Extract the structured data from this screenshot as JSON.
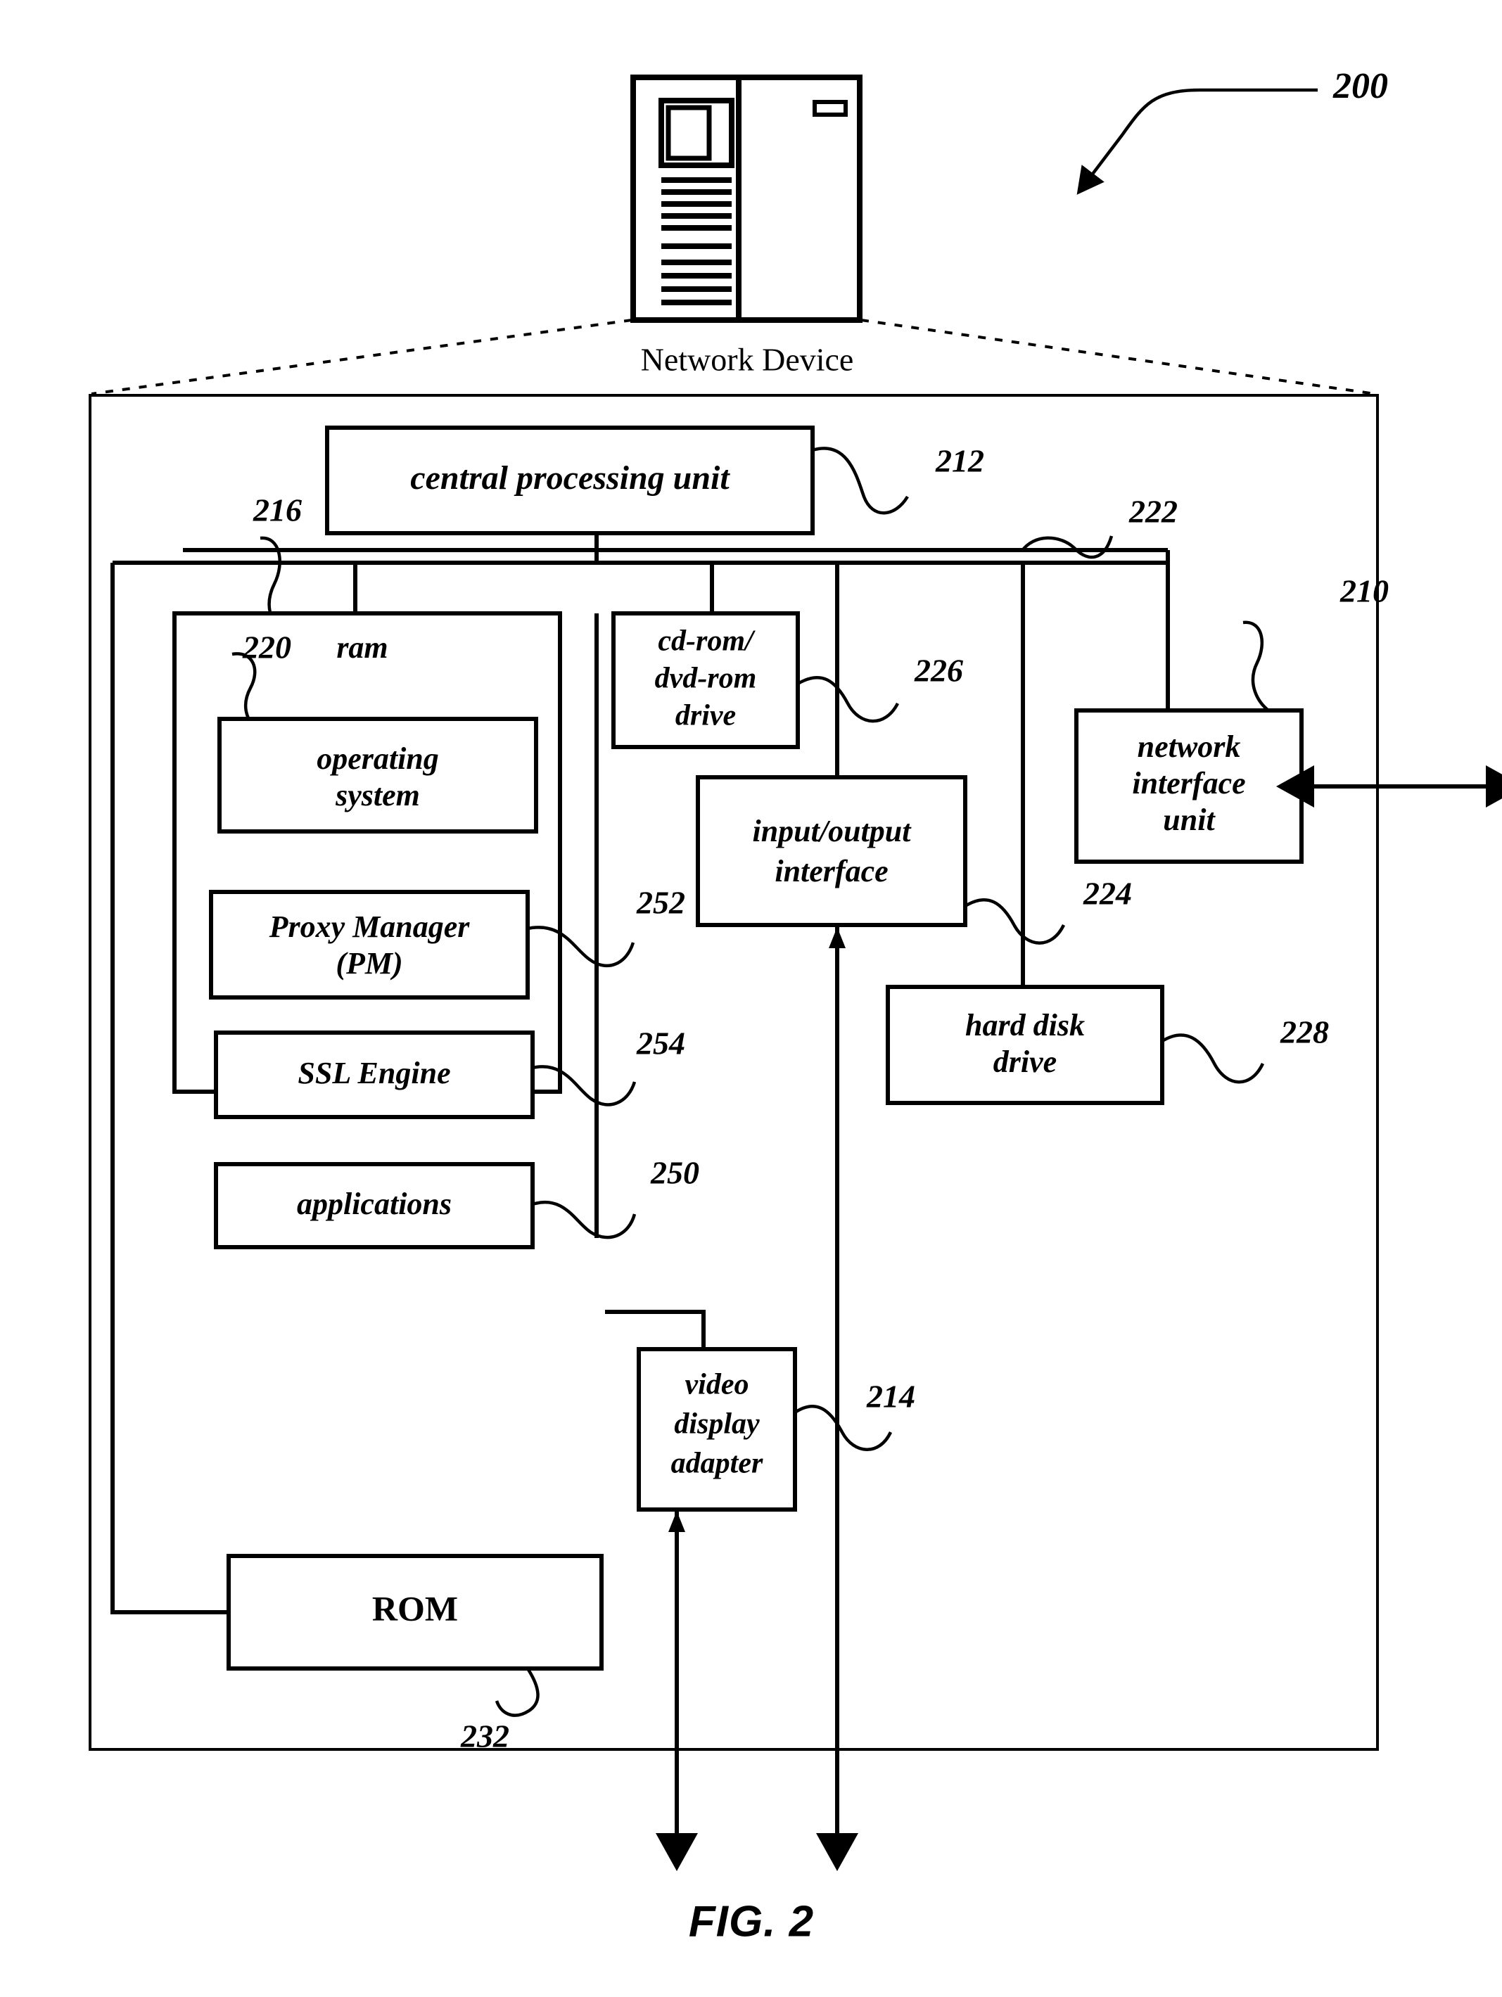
{
  "figure": {
    "caption": "FIG. 2",
    "overall_ref": "200"
  },
  "device_icon": {
    "caption": "Network Device",
    "name": "server-tower-icon"
  },
  "enclosure": {
    "ref": "210",
    "name": "network-device-internals"
  },
  "blocks": [
    {
      "id": "cpu",
      "label": "central processing unit",
      "ref": "212"
    },
    {
      "id": "ram",
      "label": "ram",
      "ref": "216"
    },
    {
      "id": "os",
      "label": "operating system",
      "ref": "220"
    },
    {
      "id": "pm",
      "label": "Proxy Manager\n(PM)",
      "ref": "252"
    },
    {
      "id": "ssl",
      "label": "SSL Engine",
      "ref": "254"
    },
    {
      "id": "apps",
      "label": "applications",
      "ref": "250"
    },
    {
      "id": "cdrom",
      "label": "cd-rom/\ndvd-rom\ndrive",
      "ref": "226"
    },
    {
      "id": "io",
      "label": "input/output\ninterface",
      "ref": ""
    },
    {
      "id": "nic",
      "label": "network\ninterface\nunit",
      "ref": "210"
    },
    {
      "id": "hdd",
      "label": "hard disk\ndrive",
      "ref": "228"
    },
    {
      "id": "vda",
      "label": "video\ndisplay\nadapter",
      "ref": "214"
    },
    {
      "id": "rom",
      "label": "ROM",
      "ref": "232"
    }
  ],
  "block_text": {
    "cpu": "central processing unit",
    "ram": "ram",
    "os_line1": "operating",
    "os_line2": "system",
    "pm_line1": "Proxy Manager",
    "pm_line2": "(PM)",
    "ssl": "SSL Engine",
    "apps": "applications",
    "cdrom_line1": "cd-rom/",
    "cdrom_line2": "dvd-rom",
    "cdrom_line3": "drive",
    "io_line1": "input/output",
    "io_line2": "interface",
    "nic_line1": "network",
    "nic_line2": "interface",
    "nic_line3": "unit",
    "hdd_line1": "hard disk",
    "hdd_line2": "drive",
    "vda_line1": "video",
    "vda_line2": "display",
    "vda_line3": "adapter",
    "rom": "ROM"
  },
  "reference_numerals": {
    "n200": "200",
    "n210": "210",
    "n212": "212",
    "n214": "214",
    "n216": "216",
    "n220": "220",
    "n222": "222",
    "n224": "224",
    "n226": "226",
    "n228": "228",
    "n232": "232",
    "n250": "250",
    "n252": "252",
    "n254": "254"
  },
  "colors": {
    "ink": "#000000",
    "paper": "#ffffff"
  }
}
